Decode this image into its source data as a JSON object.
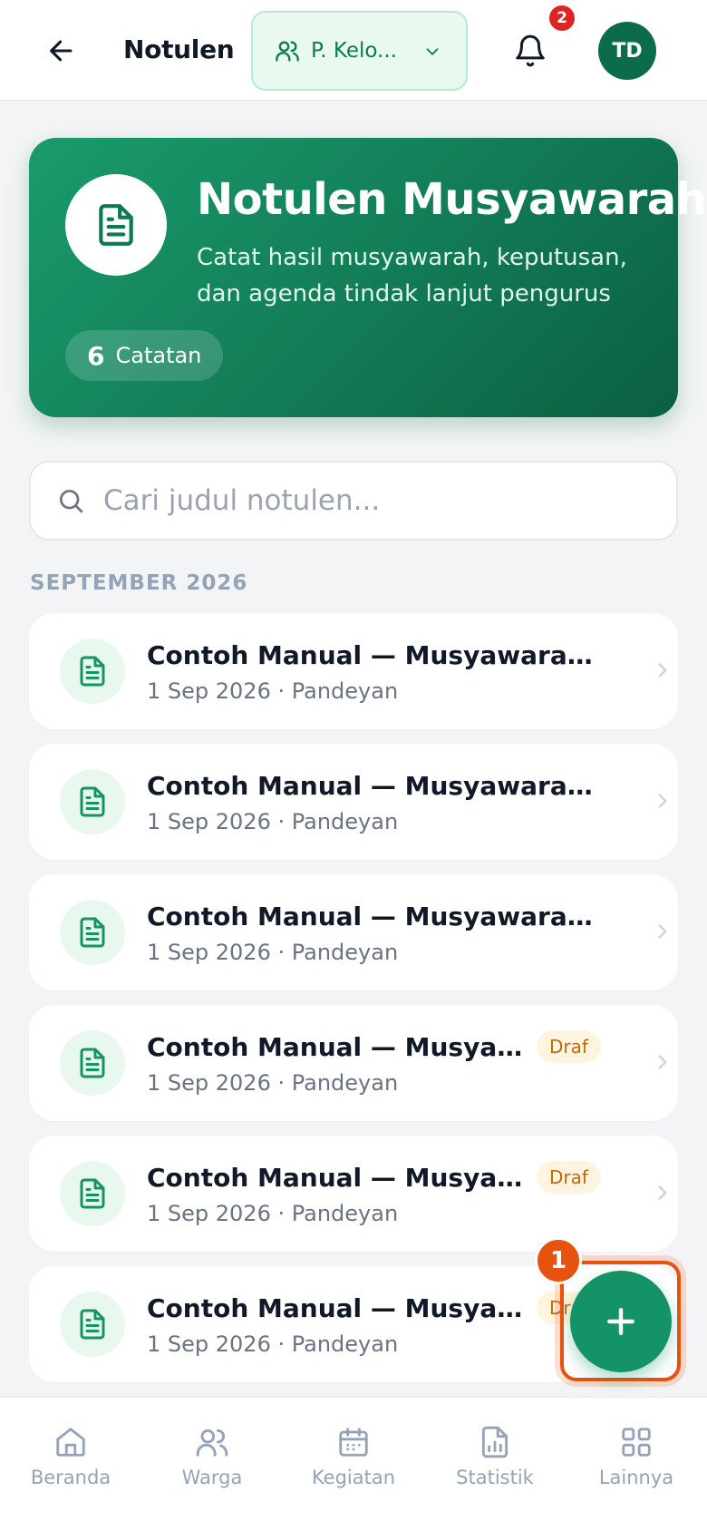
{
  "header": {
    "title": "Notulen",
    "group_select": "P. Kelo...",
    "notification_count": "2",
    "avatar_initials": "TD"
  },
  "hero": {
    "title": "Notulen Musyawarah",
    "subtitle": "Catat hasil musyawarah, keputusan, dan agenda tindak lanjut pengurus",
    "count": "6",
    "count_label": "Catatan"
  },
  "search": {
    "placeholder": "Cari judul notulen..."
  },
  "section": {
    "label": "SEPTEMBER 2026"
  },
  "notes": [
    {
      "title": "Contoh Manual — Musyawarah Kelo...",
      "meta": "1 Sep 2026 · Pandeyan",
      "status": ""
    },
    {
      "title": "Contoh Manual — Musyawarah Kelo...",
      "meta": "1 Sep 2026 · Pandeyan",
      "status": ""
    },
    {
      "title": "Contoh Manual — Musyawarah Kelo...",
      "meta": "1 Sep 2026 · Pandeyan",
      "status": ""
    },
    {
      "title": "Contoh Manual — Musyawara...",
      "meta": "1 Sep 2026 · Pandeyan",
      "status": "Draf"
    },
    {
      "title": "Contoh Manual — Musyawara...",
      "meta": "1 Sep 2026 · Pandeyan",
      "status": "Draf"
    },
    {
      "title": "Contoh Manual — Musyawara...",
      "meta": "1 Sep 2026 · Pandeyan",
      "status": "Draf"
    }
  ],
  "fab": {
    "step_number": "1"
  },
  "nav": [
    {
      "label": "Beranda"
    },
    {
      "label": "Warga"
    },
    {
      "label": "Kegiatan"
    },
    {
      "label": "Statistik"
    },
    {
      "label": "Lainnya"
    }
  ],
  "colors": {
    "primary": "#149367",
    "primary_dark": "#0b6b4b",
    "accent_orange": "#e8520f",
    "badge_red": "#dc2626",
    "draft_text": "#c2680c"
  }
}
